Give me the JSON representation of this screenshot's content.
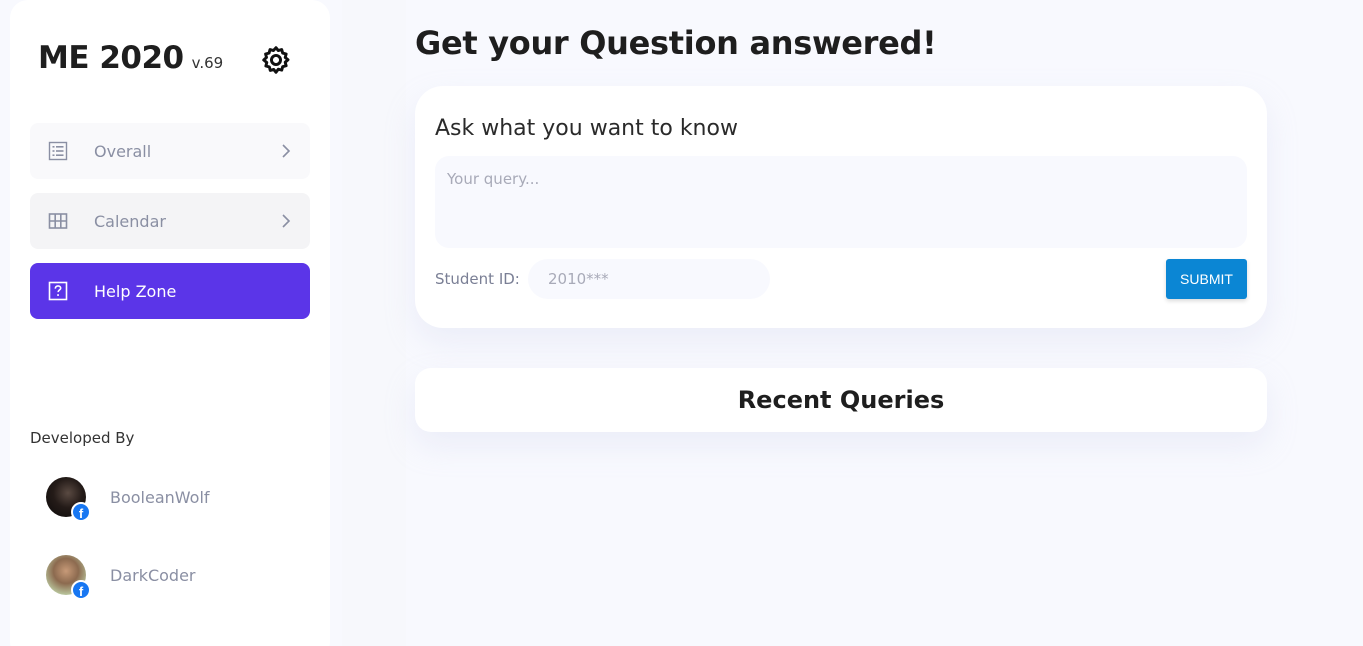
{
  "sidebar": {
    "app_title": "ME 2020",
    "version": "v.69",
    "nav": [
      {
        "label": "Overall",
        "icon": "list-icon"
      },
      {
        "label": "Calendar",
        "icon": "grid-icon"
      },
      {
        "label": "Help Zone",
        "icon": "question-icon",
        "active": true
      }
    ],
    "developers_heading": "Developed By",
    "developers": [
      {
        "name": "BooleanWolf",
        "badge": "facebook-icon"
      },
      {
        "name": "DarkCoder",
        "badge": "facebook-icon"
      }
    ]
  },
  "main": {
    "title": "Get your Question answered!",
    "ask": {
      "heading": "Ask what you want to know",
      "query_placeholder": "Your query...",
      "query_value": "",
      "student_id_label": "Student ID:",
      "student_id_placeholder": "2010***",
      "student_id_value": "",
      "submit_label": "SUBMIT"
    },
    "recent": {
      "title": "Recent Queries"
    }
  },
  "colors": {
    "accent": "#5b35e8",
    "submit": "#0b86d4",
    "background": "#f8f9fe",
    "muted_text": "#8a8fa3"
  }
}
